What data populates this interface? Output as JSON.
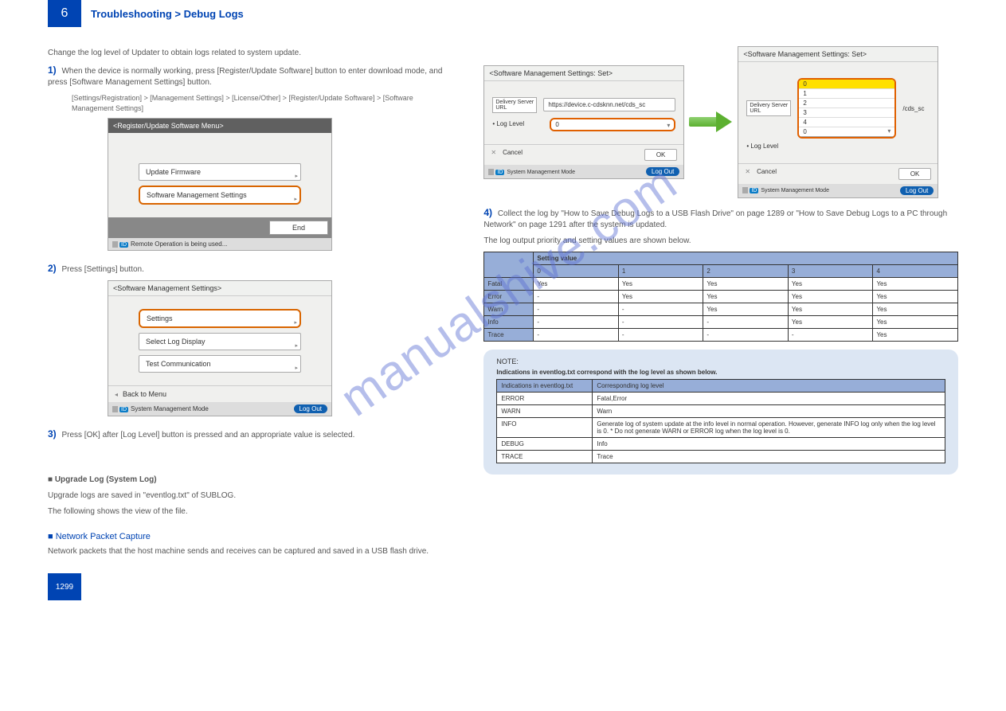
{
  "header": {
    "chapter": "6",
    "title": "Troubleshooting > Debug Logs"
  },
  "left": {
    "para1": "Change the log level of Updater to obtain logs related to system update.",
    "step1": {
      "num": "1)",
      "text": "When the device is normally working, press [Register/Update Software] button to enter download mode, and press [Software Management Settings] button."
    },
    "step1_path": "[Settings/Registration] > [Management Settings] > [License/Other] > [Register/Update Software] > [Software Management Settings]",
    "device1": {
      "title": "<Register/Update Software Menu>",
      "items": [
        "Update Firmware",
        "Software Management Settings"
      ],
      "end": "End",
      "status": "Remote Operation is being used..."
    },
    "step2": {
      "num": "2)",
      "text": "Press [Settings] button."
    },
    "device2": {
      "title": "<Software Management Settings>",
      "items": [
        "Settings",
        "Select Log Display",
        "Test Communication"
      ],
      "back": "Back to Menu",
      "status": "System Management Mode",
      "logout": "Log Out"
    },
    "step3": {
      "num": "3)",
      "text": "Press [OK] after [Log Level] button is pressed and an appropriate value is selected."
    },
    "sub_view": "■ Upgrade Log (System Log)",
    "view_p1": "Upgrade logs are saved in \"eventlog.txt\" of SUBLOG.",
    "view_p2": "The following shows the view of the file.",
    "blue_sub": "■ Network Packet Capture",
    "net_p": "Network packets that the host machine sends and receives can be captured and saved in a USB flash drive."
  },
  "right": {
    "mini1": {
      "title": "<Software Management Settings: Set>",
      "url_label": "Delivery Server URL",
      "url": "https://device.c-cdsknn.net/cds_sc",
      "log_label": "• Log Level",
      "log_value": "0",
      "cancel": "Cancel",
      "ok": "OK",
      "status": "System Management Mode",
      "logout": "Log Out"
    },
    "mini2": {
      "title": "<Software Management Settings: Set>",
      "url_label": "Delivery Server URL",
      "url_tail": "/cds_sc",
      "log_label": "• Log Level",
      "options": [
        "0",
        "1",
        "2",
        "3",
        "4",
        "0"
      ],
      "cancel": "Cancel",
      "ok": "OK",
      "status": "System Management Mode",
      "logout": "Log Out"
    },
    "step4": {
      "num": "4)",
      "text": "Collect the log by \"How to Save Debug Logs to a USB Flash Drive\" on page 1289 or \"How to Save Debug Logs to a PC through Network\" on page 1291 after the system is updated."
    },
    "priority_text": "The log output priority and setting values are shown below.",
    "priority_table": {
      "header1": "Setting value",
      "cols": [
        "0",
        "1",
        "2",
        "3",
        "4"
      ],
      "rows": [
        {
          "head": "Fatal",
          "cells": [
            "Yes",
            "Yes",
            "Yes",
            "Yes",
            "Yes"
          ]
        },
        {
          "head": "Error",
          "cells": [
            "-",
            "Yes",
            "Yes",
            "Yes",
            "Yes"
          ]
        },
        {
          "head": "Warn",
          "cells": [
            "-",
            "-",
            "Yes",
            "Yes",
            "Yes"
          ]
        },
        {
          "head": "Info",
          "cells": [
            "-",
            "-",
            "-",
            "Yes",
            "Yes"
          ]
        },
        {
          "head": "Trace",
          "cells": [
            "-",
            "-",
            "-",
            "-",
            "Yes"
          ]
        }
      ]
    },
    "note": {
      "title": "NOTE:",
      "sub": "Indications in eventlog.txt correspond with the log level as shown below.",
      "header": [
        "Indications in eventlog.txt",
        "Corresponding log level"
      ],
      "rows": [
        [
          "ERROR",
          "Fatal,Error"
        ],
        [
          "WARN",
          "Warn"
        ],
        [
          "INFO",
          "Generate log of system update at the info level in normal operation. However, generate INFO log only when the log level is 0. * Do not generate WARN or ERROR log when the log level is 0."
        ],
        [
          "DEBUG",
          "Info"
        ],
        [
          "TRACE",
          "Trace"
        ]
      ]
    }
  },
  "footer": {
    "page": "1299"
  }
}
